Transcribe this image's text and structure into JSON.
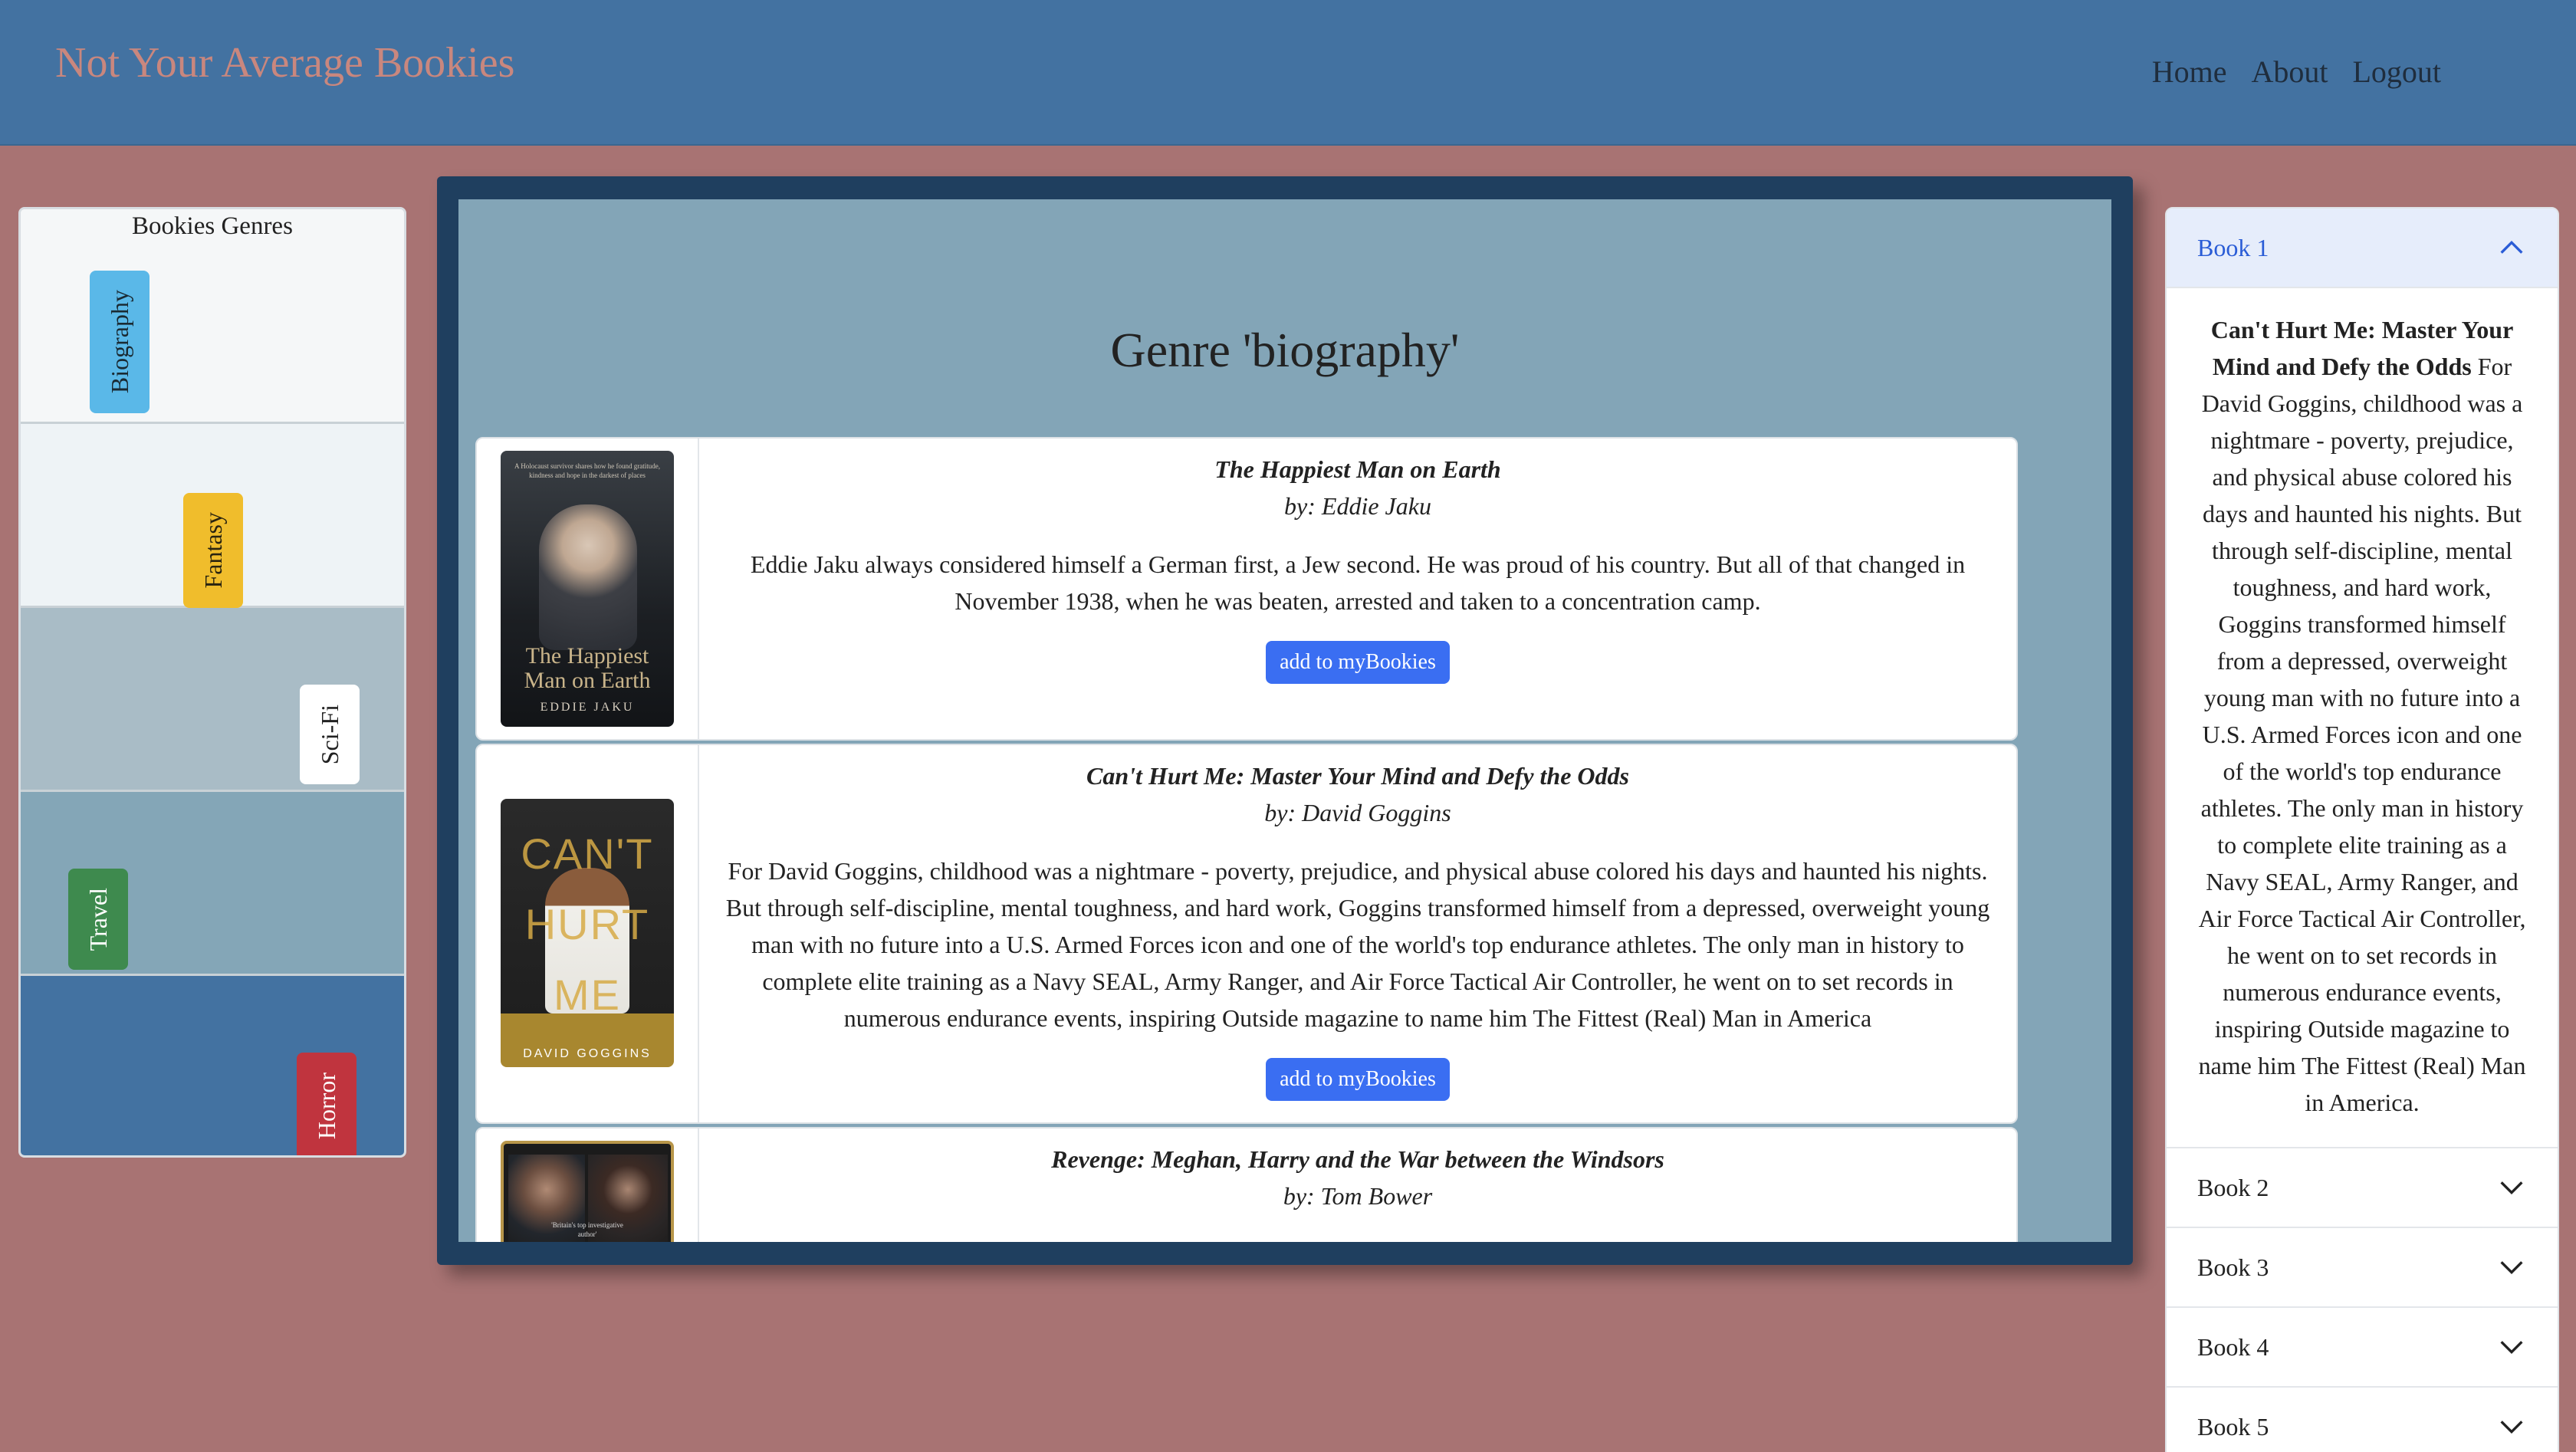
{
  "navbar": {
    "brand": "Not Your Average Bookies",
    "links": [
      "Home",
      "About",
      "Logout"
    ]
  },
  "genres": {
    "title": "Bookies Genres",
    "items": [
      {
        "label": "Biography",
        "color": "#5ab8e8"
      },
      {
        "label": "Fantasy",
        "color": "#f0bd2c"
      },
      {
        "label": "Sci-Fi",
        "color": "#ffffff"
      },
      {
        "label": "Travel",
        "color": "#3e8a4e"
      },
      {
        "label": "Horror",
        "color": "#c0343e"
      }
    ]
  },
  "main": {
    "heading": "Genre 'biography'",
    "add_label": "add to myBookies",
    "books": [
      {
        "title": "The Happiest Man on Earth",
        "author": "by: Eddie Jaku",
        "description": "Eddie Jaku always considered himself a German first, a Jew second. He was proud of his country. But all of that changed in November 1938, when he was beaten, arrested and taken to a concentration camp.",
        "cover": {
          "title": "The Happiest Man on Earth",
          "author": "EDDIE JAKU",
          "tagline": "A Holocaust survivor shares how he found gratitude, kindness and hope in the darkest of places"
        }
      },
      {
        "title": "Can't Hurt Me: Master Your Mind and Defy the Odds",
        "author": "by: David Goggins",
        "description": "For David Goggins, childhood was a nightmare - poverty, prejudice, and physical abuse colored his days and haunted his nights. But through self-discipline, mental toughness, and hard work, Goggins transformed himself from a depressed, overweight young man with no future into a U.S. Armed Forces icon and one of the world's top endurance athletes. The only man in history to complete elite training as a Navy SEAL, Army Ranger, and Air Force Tactical Air Controller, he went on to set records in numerous endurance events, inspiring Outside magazine to name him The Fittest (Real) Man in America",
        "cover": {
          "title": "CAN'T HURT ME",
          "author": "DAVID GOGGINS"
        }
      },
      {
        "title": "Revenge: Meghan, Harry and the War between the Windsors",
        "author": "by: Tom Bower",
        "description": "",
        "cover": {
          "quote": "'Britain's top investigative author'"
        }
      }
    ]
  },
  "accordion": {
    "items": [
      {
        "label": "Book 1",
        "expanded": true,
        "body_title": "Can't Hurt Me: Master Your Mind and Defy the Odds",
        "body_text": "For David Goggins, childhood was a nightmare - poverty, prejudice, and physical abuse colored his days and haunted his nights. But through self-discipline, mental toughness, and hard work, Goggins transformed himself from a depressed, overweight young man with no future into a U.S. Armed Forces icon and one of the world's top endurance athletes. The only man in history to complete elite training as a Navy SEAL, Army Ranger, and Air Force Tactical Air Controller, he went on to set records in numerous endurance events, inspiring Outside magazine to name him The Fittest (Real) Man in America."
      },
      {
        "label": "Book 2",
        "expanded": false
      },
      {
        "label": "Book 3",
        "expanded": false
      },
      {
        "label": "Book 4",
        "expanded": false
      },
      {
        "label": "Book 5",
        "expanded": false
      }
    ]
  }
}
